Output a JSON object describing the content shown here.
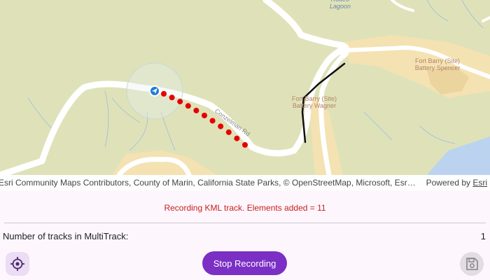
{
  "map": {
    "labels": {
      "lagoon": "Rodeo\nLagoon",
      "fort_barry_spencer": "Fort Barry (Site)\nBattery Spencer",
      "fort_barry_wagner": "Fort Barry (Site)\nBattery Wagner",
      "road": "Conzelman Rd"
    },
    "track_points_count": 11,
    "colors": {
      "land": "#dfe2b8",
      "road": "#ffffff",
      "track_dot": "#e60000",
      "track_line": "#111111",
      "water": "#bcd3f0",
      "park": "#f4e2b2"
    },
    "location_marker_icon": "navigation-arrow-icon"
  },
  "attribution": {
    "credits": "Esri Community Maps Contributors, County of Marin, California State Parks, © OpenStreetMap, Microsoft, Esri, TomTom, Garmin, SafeGraph, METI/NASA, USGS, Bureau of Land Management, EPA, NPS, US Census Bureau, USDA, USFWS",
    "powered_by": "Powered by ",
    "esri": "Esri"
  },
  "status": {
    "message": "Recording KML track. Elements added = 11"
  },
  "tracks": {
    "label": "Number of tracks in MultiTrack:",
    "value": "1"
  },
  "buttons": {
    "stop_recording": "Stop Recording",
    "location_icon": "gps-crosshair-icon",
    "save_icon": "save-disk-icon"
  }
}
